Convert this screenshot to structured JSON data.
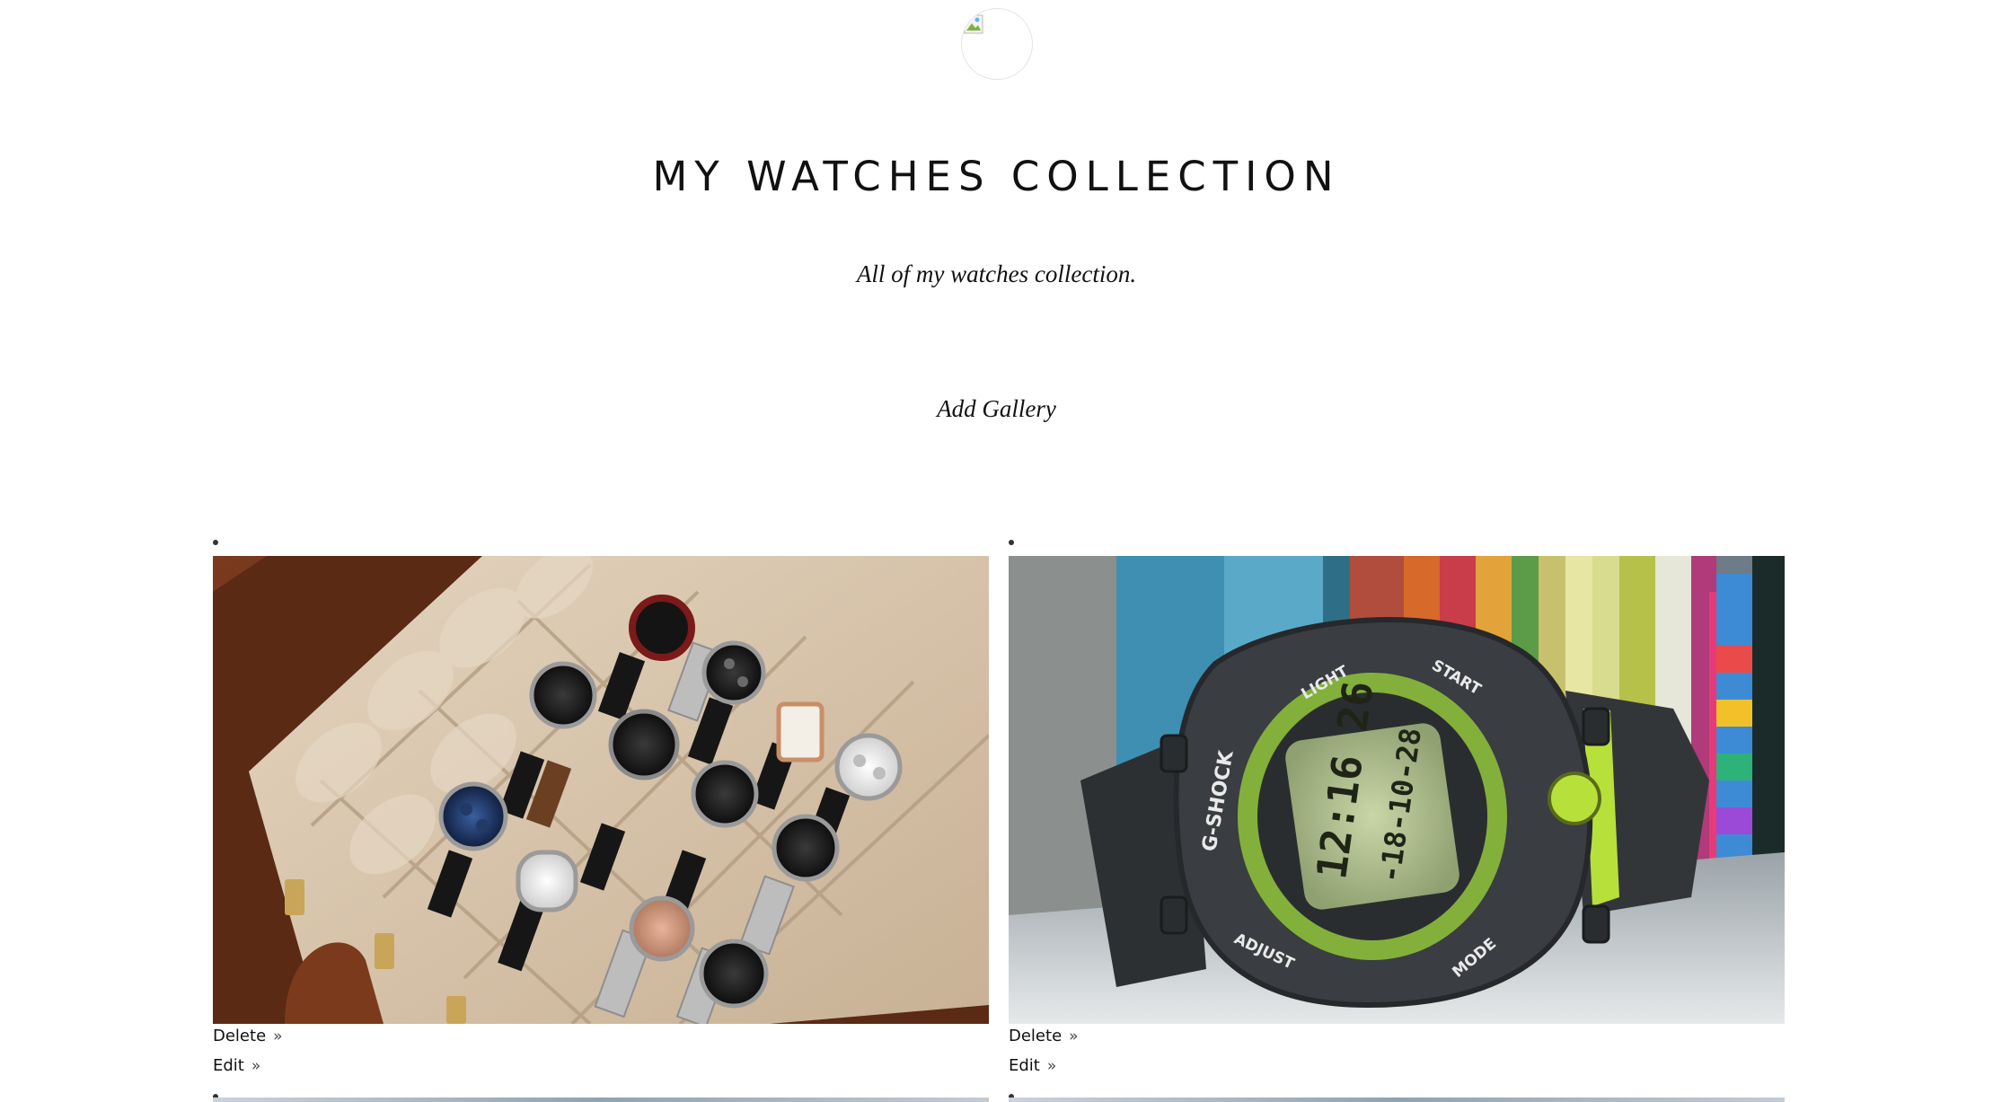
{
  "header": {
    "title": "MY WATCHES COLLECTION",
    "tagline": "All of my watches collection."
  },
  "actions": {
    "add_gallery": "Add Gallery"
  },
  "gallery": {
    "items": [
      {
        "image_icon": "watch-case-photo",
        "delete_label": "Delete",
        "edit_label": "Edit",
        "link_arrow": "»"
      },
      {
        "image_icon": "gshock-watch-photo",
        "delete_label": "Delete",
        "edit_label": "Edit",
        "link_arrow": "»"
      }
    ]
  },
  "colors": {
    "background": "#ffffff",
    "text": "#111111",
    "case_leather": "#6b2f16",
    "case_lining": "#d9c6ad",
    "gshock_body": "#3a3d41",
    "gshock_accent": "#b7e03a"
  }
}
